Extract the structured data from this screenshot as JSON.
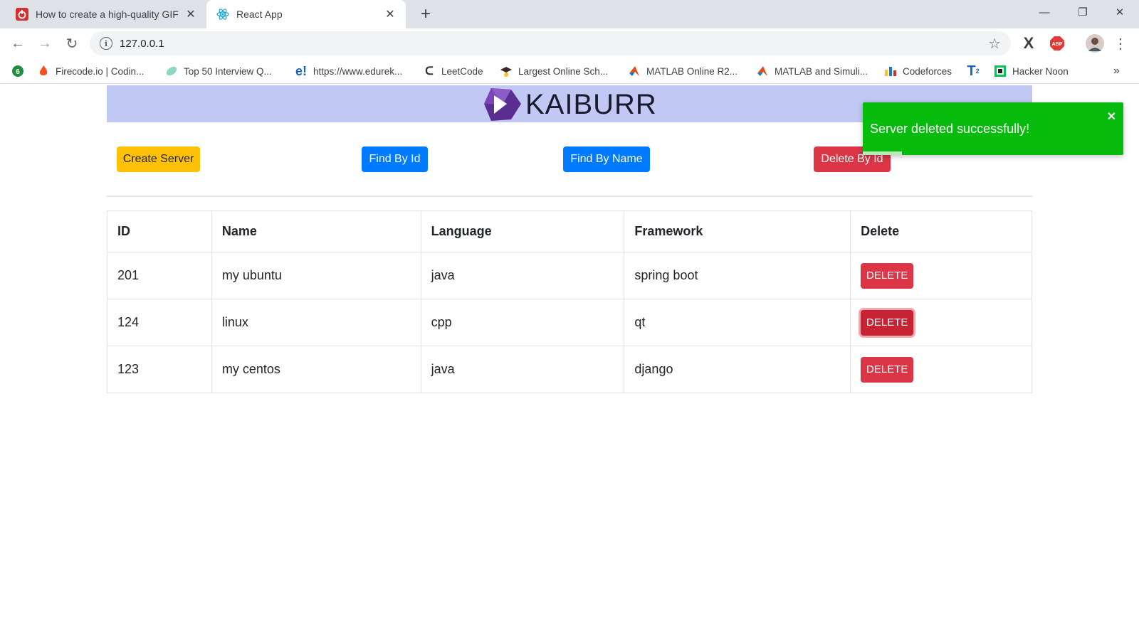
{
  "browser": {
    "tabs": [
      {
        "title": "How to create a high-quality GIF",
        "favicon": "power-icon",
        "active": false
      },
      {
        "title": "React App",
        "favicon": "react-icon",
        "active": true
      }
    ],
    "new_tab": "+",
    "url": "127.0.0.1",
    "window_controls": {
      "minimize": "—",
      "restore": "❐",
      "close": "✕"
    },
    "bookmarks": [
      {
        "label": "",
        "icon": "green-badge-icon"
      },
      {
        "label": "Firecode.io | Codin...",
        "icon": "firecode-icon"
      },
      {
        "label": "Top 50 Interview Q...",
        "icon": "leaf-icon"
      },
      {
        "label": "https://www.edurek...",
        "icon": "edureka-icon"
      },
      {
        "label": "LeetCode",
        "icon": "leetcode-icon"
      },
      {
        "label": "Largest Online Sch...",
        "icon": "graduation-icon"
      },
      {
        "label": "MATLAB Online R2...",
        "icon": "matlab-icon"
      },
      {
        "label": "MATLAB and Simuli...",
        "icon": "matlab-icon"
      },
      {
        "label": "Codeforces",
        "icon": "codeforces-icon"
      },
      {
        "label": "",
        "icon": "t2-icon"
      },
      {
        "label": "Hacker Noon",
        "icon": "hackernoon-icon"
      }
    ],
    "bookmarks_overflow": "»"
  },
  "app": {
    "logo_text": "KAIBURR",
    "buttons": {
      "create": "Create Server",
      "find_by_id": "Find By Id",
      "find_by_name": "Find By Name",
      "delete_by_id": "Delete By Id"
    },
    "table": {
      "headers": [
        "ID",
        "Name",
        "Language",
        "Framework",
        "Delete"
      ],
      "rows": [
        {
          "id": "201",
          "name": "my ubuntu",
          "language": "java",
          "framework": "spring boot",
          "action": "DELETE"
        },
        {
          "id": "124",
          "name": "linux",
          "language": "cpp",
          "framework": "qt",
          "action": "DELETE"
        },
        {
          "id": "123",
          "name": "my centos",
          "language": "java",
          "framework": "django",
          "action": "DELETE"
        }
      ]
    }
  },
  "toast": {
    "message": "Server deleted successfully!",
    "close": "✕",
    "progress": 0.15,
    "color": "#07bc0c"
  },
  "colors": {
    "banner": "#c1c8f3",
    "warning": "#ffc107",
    "primary": "#007bff",
    "danger": "#dc3545"
  }
}
